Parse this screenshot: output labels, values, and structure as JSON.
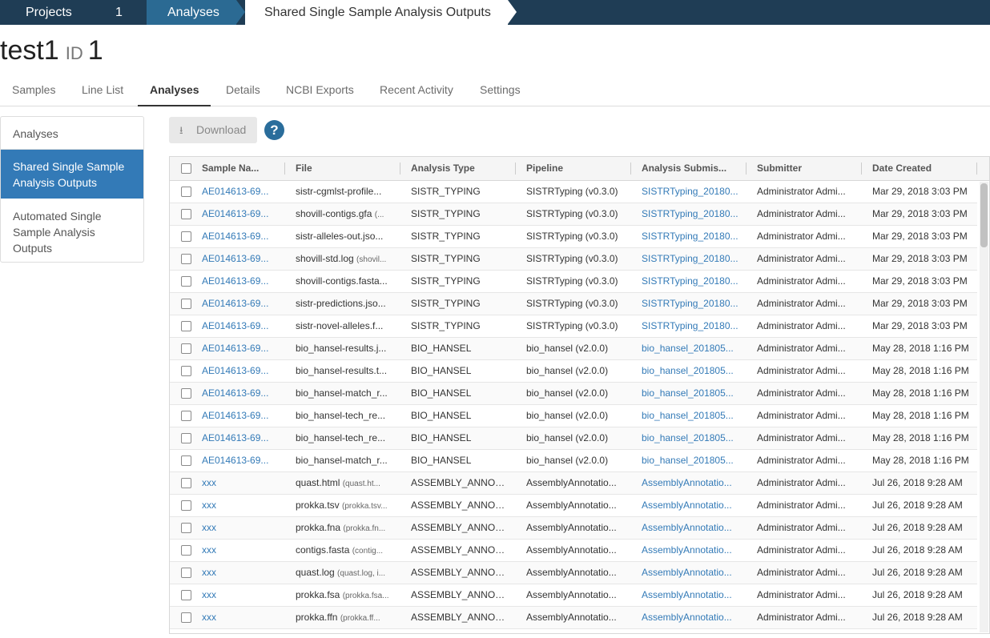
{
  "breadcrumb": {
    "items": [
      {
        "label": "Projects"
      },
      {
        "label": "1"
      },
      {
        "label": "Analyses"
      },
      {
        "label": "Shared Single Sample Analysis Outputs"
      }
    ]
  },
  "project": {
    "name": "test1",
    "id_label": "ID",
    "id_value": "1"
  },
  "tabs": [
    {
      "label": "Samples"
    },
    {
      "label": "Line List"
    },
    {
      "label": "Analyses"
    },
    {
      "label": "Details"
    },
    {
      "label": "NCBI Exports"
    },
    {
      "label": "Recent Activity"
    },
    {
      "label": "Settings"
    }
  ],
  "sidebar": {
    "items": [
      {
        "label": "Analyses"
      },
      {
        "label": "Shared Single Sample Analysis Outputs"
      },
      {
        "label": "Automated Single Sample Analysis Outputs"
      }
    ]
  },
  "toolbar": {
    "download_label": "Download",
    "download_icon": "download-icon",
    "help_label": "?"
  },
  "colors": {
    "breadcrumb_dark": "#1f3d55",
    "breadcrumb_active": "#2b6a93",
    "link": "#337ab7",
    "sidebar_active": "#337ab7"
  },
  "table": {
    "headers": [
      "Sample Na...",
      "File",
      "Analysis Type",
      "Pipeline",
      "Analysis Submis...",
      "Submitter",
      "Date Created"
    ],
    "rows": [
      {
        "sample": "AE014613-69...",
        "file": "sistr-cgmlst-profile...",
        "file_sub": "",
        "type": "SISTR_TYPING",
        "pipeline": "SISTRTyping (v0.3.0)",
        "submission": "SISTRTyping_20180...",
        "submitter": "Administrator Admi...",
        "date": "Mar 29, 2018 3:03 PM"
      },
      {
        "sample": "AE014613-69...",
        "file": "shovill-contigs.gfa",
        "file_sub": "(...",
        "type": "SISTR_TYPING",
        "pipeline": "SISTRTyping (v0.3.0)",
        "submission": "SISTRTyping_20180...",
        "submitter": "Administrator Admi...",
        "date": "Mar 29, 2018 3:03 PM"
      },
      {
        "sample": "AE014613-69...",
        "file": "sistr-alleles-out.jso...",
        "file_sub": "",
        "type": "SISTR_TYPING",
        "pipeline": "SISTRTyping (v0.3.0)",
        "submission": "SISTRTyping_20180...",
        "submitter": "Administrator Admi...",
        "date": "Mar 29, 2018 3:03 PM"
      },
      {
        "sample": "AE014613-69...",
        "file": "shovill-std.log",
        "file_sub": "(shovil...",
        "type": "SISTR_TYPING",
        "pipeline": "SISTRTyping (v0.3.0)",
        "submission": "SISTRTyping_20180...",
        "submitter": "Administrator Admi...",
        "date": "Mar 29, 2018 3:03 PM"
      },
      {
        "sample": "AE014613-69...",
        "file": "shovill-contigs.fasta...",
        "file_sub": "",
        "type": "SISTR_TYPING",
        "pipeline": "SISTRTyping (v0.3.0)",
        "submission": "SISTRTyping_20180...",
        "submitter": "Administrator Admi...",
        "date": "Mar 29, 2018 3:03 PM"
      },
      {
        "sample": "AE014613-69...",
        "file": "sistr-predictions.jso...",
        "file_sub": "",
        "type": "SISTR_TYPING",
        "pipeline": "SISTRTyping (v0.3.0)",
        "submission": "SISTRTyping_20180...",
        "submitter": "Administrator Admi...",
        "date": "Mar 29, 2018 3:03 PM"
      },
      {
        "sample": "AE014613-69...",
        "file": "sistr-novel-alleles.f...",
        "file_sub": "",
        "type": "SISTR_TYPING",
        "pipeline": "SISTRTyping (v0.3.0)",
        "submission": "SISTRTyping_20180...",
        "submitter": "Administrator Admi...",
        "date": "Mar 29, 2018 3:03 PM"
      },
      {
        "sample": "AE014613-69...",
        "file": "bio_hansel-results.j...",
        "file_sub": "",
        "type": "BIO_HANSEL",
        "pipeline": "bio_hansel (v2.0.0)",
        "submission": "bio_hansel_201805...",
        "submitter": "Administrator Admi...",
        "date": "May 28, 2018 1:16 PM"
      },
      {
        "sample": "AE014613-69...",
        "file": "bio_hansel-results.t...",
        "file_sub": "",
        "type": "BIO_HANSEL",
        "pipeline": "bio_hansel (v2.0.0)",
        "submission": "bio_hansel_201805...",
        "submitter": "Administrator Admi...",
        "date": "May 28, 2018 1:16 PM"
      },
      {
        "sample": "AE014613-69...",
        "file": "bio_hansel-match_r...",
        "file_sub": "",
        "type": "BIO_HANSEL",
        "pipeline": "bio_hansel (v2.0.0)",
        "submission": "bio_hansel_201805...",
        "submitter": "Administrator Admi...",
        "date": "May 28, 2018 1:16 PM"
      },
      {
        "sample": "AE014613-69...",
        "file": "bio_hansel-tech_re...",
        "file_sub": "",
        "type": "BIO_HANSEL",
        "pipeline": "bio_hansel (v2.0.0)",
        "submission": "bio_hansel_201805...",
        "submitter": "Administrator Admi...",
        "date": "May 28, 2018 1:16 PM"
      },
      {
        "sample": "AE014613-69...",
        "file": "bio_hansel-tech_re...",
        "file_sub": "",
        "type": "BIO_HANSEL",
        "pipeline": "bio_hansel (v2.0.0)",
        "submission": "bio_hansel_201805...",
        "submitter": "Administrator Admi...",
        "date": "May 28, 2018 1:16 PM"
      },
      {
        "sample": "AE014613-69...",
        "file": "bio_hansel-match_r...",
        "file_sub": "",
        "type": "BIO_HANSEL",
        "pipeline": "bio_hansel (v2.0.0)",
        "submission": "bio_hansel_201805...",
        "submitter": "Administrator Admi...",
        "date": "May 28, 2018 1:16 PM"
      },
      {
        "sample": "xxx",
        "file": "quast.html",
        "file_sub": "(quast.ht...",
        "type": "ASSEMBLY_ANNOT...",
        "pipeline": "AssemblyAnnotatio...",
        "submission": "AssemblyAnnotatio...",
        "submitter": "Administrator Admi...",
        "date": "Jul 26, 2018 9:28 AM"
      },
      {
        "sample": "xxx",
        "file": "prokka.tsv",
        "file_sub": "(prokka.tsv...",
        "type": "ASSEMBLY_ANNOT...",
        "pipeline": "AssemblyAnnotatio...",
        "submission": "AssemblyAnnotatio...",
        "submitter": "Administrator Admi...",
        "date": "Jul 26, 2018 9:28 AM"
      },
      {
        "sample": "xxx",
        "file": "prokka.fna",
        "file_sub": "(prokka.fn...",
        "type": "ASSEMBLY_ANNOT...",
        "pipeline": "AssemblyAnnotatio...",
        "submission": "AssemblyAnnotatio...",
        "submitter": "Administrator Admi...",
        "date": "Jul 26, 2018 9:28 AM"
      },
      {
        "sample": "xxx",
        "file": "contigs.fasta",
        "file_sub": "(contig...",
        "type": "ASSEMBLY_ANNOT...",
        "pipeline": "AssemblyAnnotatio...",
        "submission": "AssemblyAnnotatio...",
        "submitter": "Administrator Admi...",
        "date": "Jul 26, 2018 9:28 AM"
      },
      {
        "sample": "xxx",
        "file": "quast.log",
        "file_sub": "(quast.log, i...",
        "type": "ASSEMBLY_ANNOT...",
        "pipeline": "AssemblyAnnotatio...",
        "submission": "AssemblyAnnotatio...",
        "submitter": "Administrator Admi...",
        "date": "Jul 26, 2018 9:28 AM"
      },
      {
        "sample": "xxx",
        "file": "prokka.fsa",
        "file_sub": "(prokka.fsa...",
        "type": "ASSEMBLY_ANNOT...",
        "pipeline": "AssemblyAnnotatio...",
        "submission": "AssemblyAnnotatio...",
        "submitter": "Administrator Admi...",
        "date": "Jul 26, 2018 9:28 AM"
      },
      {
        "sample": "xxx",
        "file": "prokka.ffn",
        "file_sub": "(prokka.ff...",
        "type": "ASSEMBLY_ANNOT...",
        "pipeline": "AssemblyAnnotatio...",
        "submission": "AssemblyAnnotatio...",
        "submitter": "Administrator Admi...",
        "date": "Jul 26, 2018 9:28 AM"
      }
    ]
  }
}
